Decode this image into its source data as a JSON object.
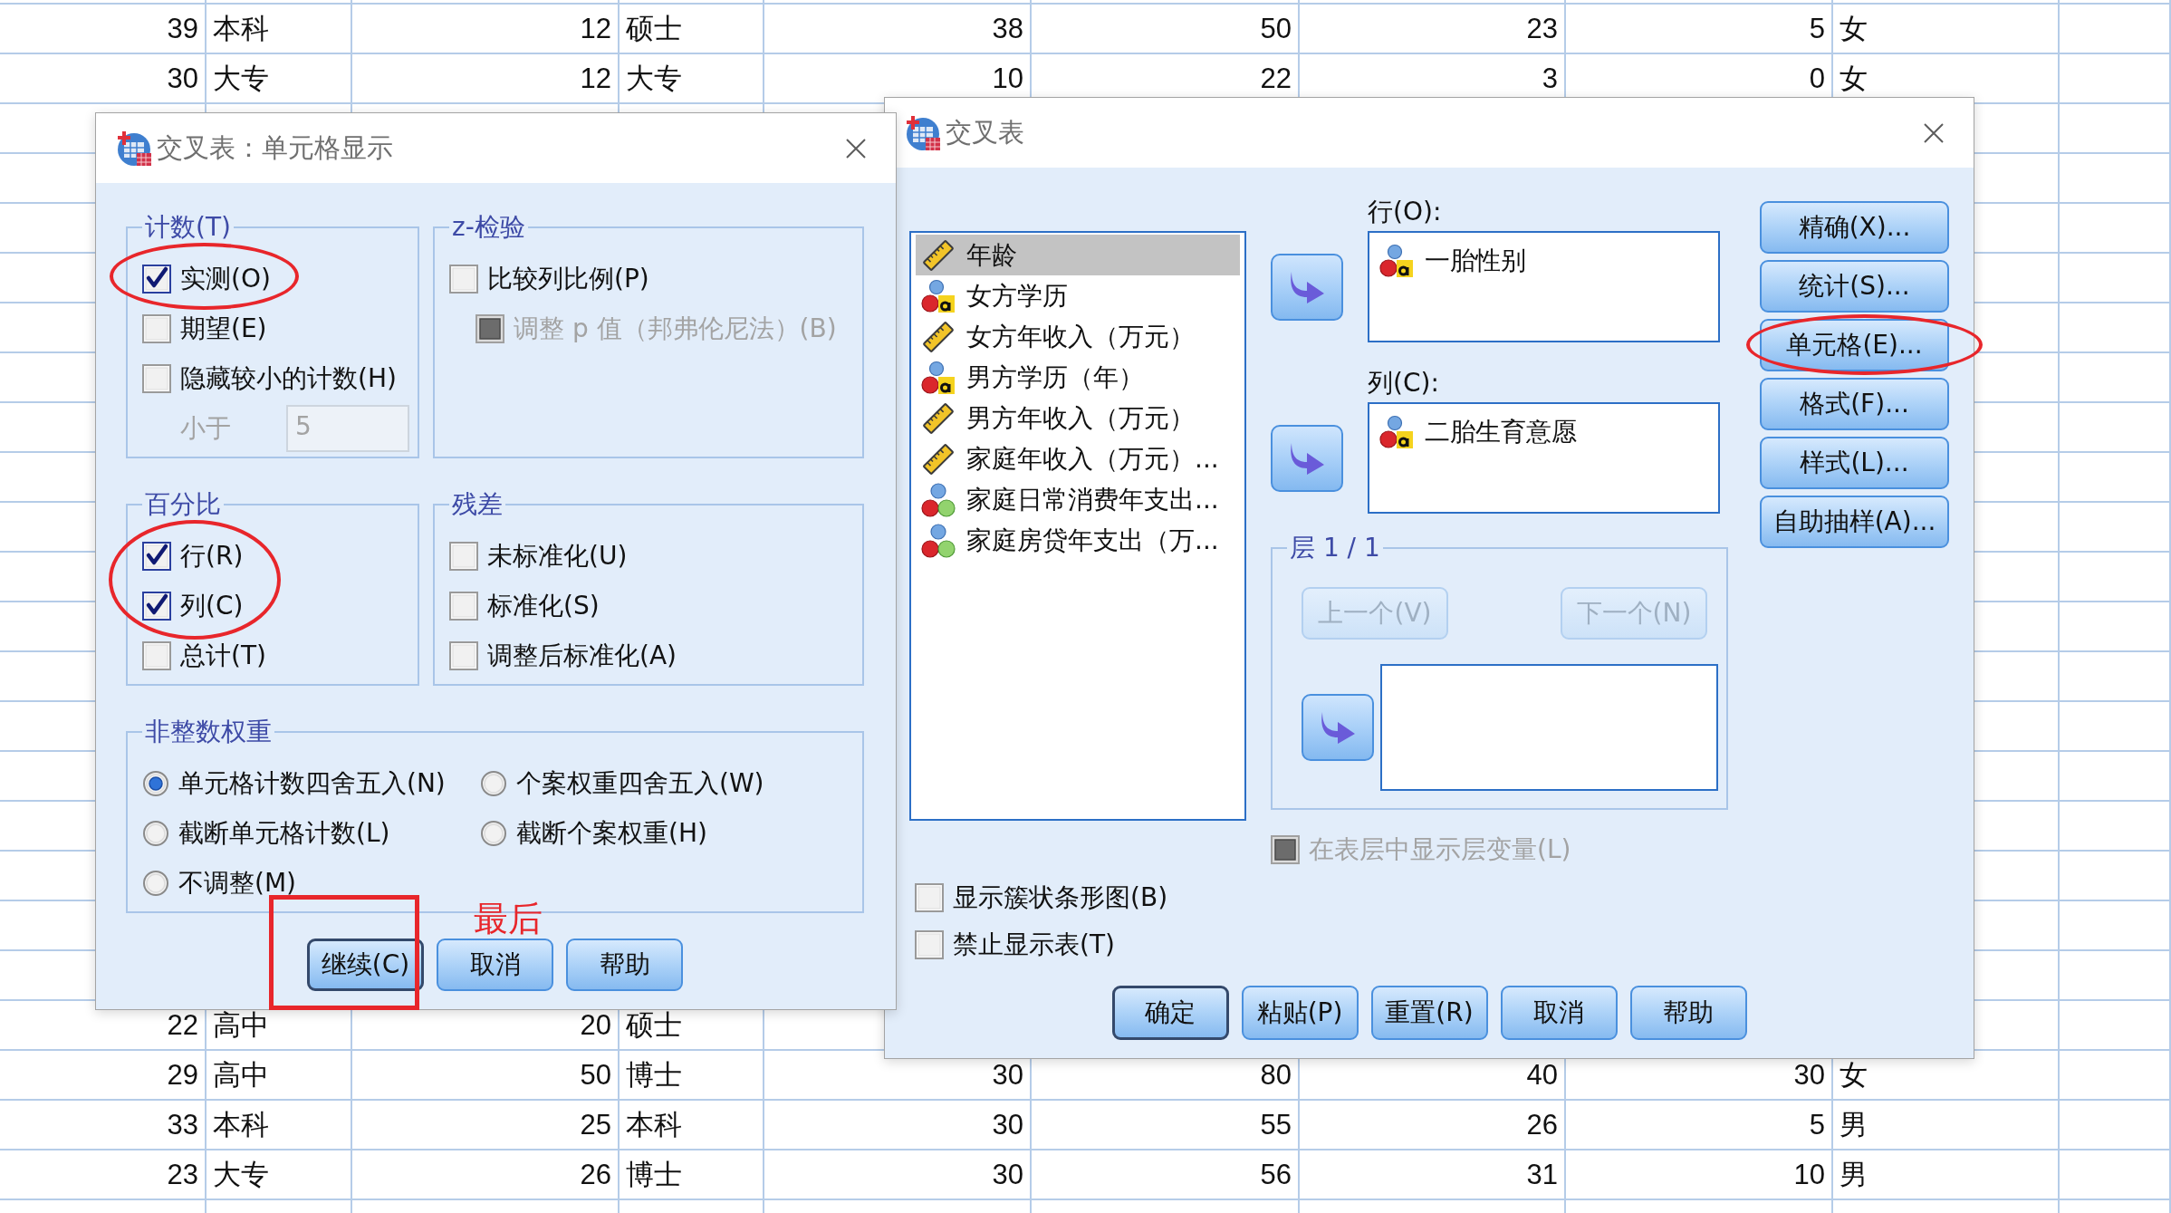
{
  "sheet": {
    "top_rows": [
      [
        "39",
        "本科",
        "12",
        "硕士",
        "38",
        "50",
        "23",
        "5",
        "女"
      ],
      [
        "30",
        "大专",
        "12",
        "大专",
        "10",
        "22",
        "3",
        "0",
        "女"
      ]
    ],
    "bottom_rows": [
      [
        "22",
        "高中",
        "20",
        "硕士"
      ],
      [
        "29",
        "高中",
        "50",
        "博士",
        "30",
        "80",
        "40",
        "30",
        "女"
      ],
      [
        "33",
        "本科",
        "25",
        "本科",
        "30",
        "55",
        "26",
        "5",
        "男"
      ],
      [
        "23",
        "大专",
        "26",
        "博士",
        "30",
        "56",
        "31",
        "10",
        "男"
      ]
    ]
  },
  "crosstabs_dialog": {
    "title": "交叉表",
    "variables": [
      {
        "name": "年龄",
        "kind": "scale",
        "selected": true
      },
      {
        "name": "女方学历",
        "kind": "nominal_string",
        "selected": false
      },
      {
        "name": "女方年收入（万元）",
        "kind": "scale",
        "selected": false
      },
      {
        "name": "男方学历（年）",
        "kind": "nominal_string",
        "selected": false
      },
      {
        "name": "男方年收入（万元）",
        "kind": "scale",
        "selected": false
      },
      {
        "name": "家庭年收入（万元）...",
        "kind": "scale",
        "selected": false
      },
      {
        "name": "家庭日常消费年支出...",
        "kind": "nominal",
        "selected": false
      },
      {
        "name": "家庭房贷年支出（万...",
        "kind": "nominal",
        "selected": false
      }
    ],
    "row_list": {
      "label": "行(O):",
      "items": [
        {
          "name": "一胎性别",
          "kind": "nominal_string"
        }
      ]
    },
    "column_list": {
      "label": "列(C):",
      "items": [
        {
          "name": "二胎生育意愿",
          "kind": "nominal_string"
        }
      ]
    },
    "layer": {
      "title": "层 1 / 1",
      "buttons": [
        {
          "label": "上一个(V)",
          "disabled": true
        },
        {
          "label": "下一个(N)",
          "disabled": true
        }
      ]
    },
    "display_layer_variables": {
      "label": "在表层中显示层变量(L)",
      "checked": false,
      "disabled": true
    },
    "options": [
      {
        "label": "显示簇状条形图(B)",
        "checked": false
      },
      {
        "label": "禁止显示表(T)",
        "checked": false
      }
    ],
    "side_buttons": [
      {
        "label": "精确(X)..."
      },
      {
        "label": "统计(S)..."
      },
      {
        "label": "单元格(E)...",
        "annotation": {
          "kind": "ellipse"
        }
      },
      {
        "label": "格式(F)..."
      },
      {
        "label": "样式(L)..."
      },
      {
        "label": "自助抽样(A)..."
      }
    ],
    "buttons": [
      {
        "label": "确定",
        "default": true
      },
      {
        "label": "粘贴(P)",
        "default": false
      },
      {
        "label": "重置(R)",
        "default": false
      },
      {
        "label": "取消",
        "default": false
      },
      {
        "label": "帮助",
        "default": false
      }
    ]
  },
  "cell_display_dialog": {
    "title": "交叉表：单元格显示",
    "groups": [
      {
        "kind": "checkboxes",
        "title": "计数(T)",
        "items": [
          {
            "kind": "checkbox",
            "label": "实测(O)",
            "checked": true,
            "disabled": false,
            "annotation": {
              "kind": "ellipse"
            }
          },
          {
            "kind": "checkbox",
            "label": "期望(E)",
            "checked": false,
            "disabled": false
          },
          {
            "kind": "checkbox",
            "label": "隐藏较小的计数(H)",
            "checked": false,
            "disabled": false
          },
          {
            "kind": "threshold",
            "label": "小于",
            "value": "5",
            "disabled": true
          }
        ]
      },
      {
        "kind": "checkboxes",
        "title": "z-检验",
        "items": [
          {
            "kind": "checkbox",
            "label": "比较列比例(P)",
            "checked": false,
            "disabled": false,
            "children": [
              {
                "kind": "checkbox",
                "label": "调整 p 值（邦弗伦尼法）(B)",
                "checked": false,
                "disabled": true
              }
            ]
          }
        ]
      },
      {
        "kind": "checkboxes",
        "title": "百分比",
        "items": [
          {
            "kind": "checkbox",
            "label": "行(R)",
            "checked": true,
            "disabled": false,
            "annotation": {
              "kind": "ellipse"
            }
          },
          {
            "kind": "checkbox",
            "label": "列(C)",
            "checked": true,
            "disabled": false,
            "annotation": {
              "kind": "ellipse"
            }
          },
          {
            "kind": "checkbox",
            "label": "总计(T)",
            "checked": false,
            "disabled": false
          }
        ]
      },
      {
        "kind": "checkboxes",
        "title": "残差",
        "items": [
          {
            "kind": "checkbox",
            "label": "未标准化(U)",
            "checked": false,
            "disabled": false
          },
          {
            "kind": "checkbox",
            "label": "标准化(S)",
            "checked": false,
            "disabled": false
          },
          {
            "kind": "checkbox",
            "label": "调整后标准化(A)",
            "checked": false,
            "disabled": false
          }
        ]
      },
      {
        "kind": "radios",
        "title": "非整数权重",
        "items": [
          {
            "label": "单元格计数四舍五入(N)",
            "selected": true
          },
          {
            "label": "个案权重四舍五入(W)",
            "selected": false
          },
          {
            "label": "截断单元格计数(L)",
            "selected": false
          },
          {
            "label": "截断个案权重(H)",
            "selected": false
          },
          {
            "label": "不调整(M)",
            "selected": false
          }
        ]
      }
    ],
    "buttons": [
      {
        "label": "继续(C)",
        "default": true,
        "annotation": {
          "kind": "rectangle",
          "note": "最后"
        }
      },
      {
        "label": "取消",
        "default": false
      },
      {
        "label": "帮助",
        "default": false
      }
    ]
  }
}
